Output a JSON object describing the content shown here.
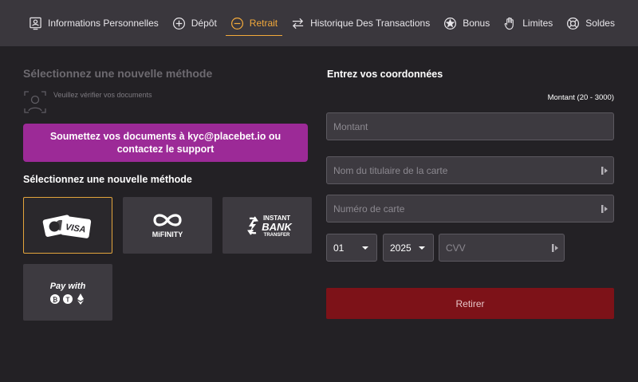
{
  "nav": {
    "items": [
      {
        "label": "Informations Personnelles",
        "icon": "id-card-icon"
      },
      {
        "label": "Dépôt",
        "icon": "plus-circle-icon"
      },
      {
        "label": "Retrait",
        "icon": "minus-circle-icon",
        "active": true
      },
      {
        "label": "Historique Des Transactions",
        "icon": "swap-arrows-icon"
      },
      {
        "label": "Bonus",
        "icon": "star-circle-icon"
      },
      {
        "label": "Limites",
        "icon": "hand-icon"
      },
      {
        "label": "Soldes",
        "icon": "lifebuoy-icon"
      }
    ],
    "active_color": "#f2a93b"
  },
  "left": {
    "heading_top": "Sélectionnez une nouvelle méthode",
    "verify_text": "Veuillez vérifier vos documents",
    "kyc_banner": "Soumettez vos documents à kyc@placebet.io ou contactez le support",
    "heading_methods": "Sélectionnez une nouvelle méthode",
    "methods": [
      {
        "name": "visa",
        "label": "VISA",
        "selected": true
      },
      {
        "name": "mifinity",
        "label": "MiFINITY"
      },
      {
        "name": "instant-bank-transfer",
        "label_line1": "INSTANT",
        "label_line2": "BANK",
        "label_line3": "TRANSFER"
      },
      {
        "name": "pay-with-crypto",
        "label": "Pay with"
      }
    ]
  },
  "right": {
    "heading": "Entrez vos coordonnées",
    "amount_hint": "Montant (20 - 3000)",
    "amount_placeholder": "Montant",
    "holder_placeholder": "Nom du titulaire de la carte",
    "card_number_placeholder": "Numéro de carte",
    "month_value": "01",
    "year_value": "2025",
    "cvv_placeholder": "CVV",
    "withdraw_label": "Retirer"
  },
  "colors": {
    "background": "#232125",
    "nav_background": "#3a373d",
    "banner": "#9c2a97",
    "button": "#7d1218",
    "selected_border": "#e3a43c"
  }
}
